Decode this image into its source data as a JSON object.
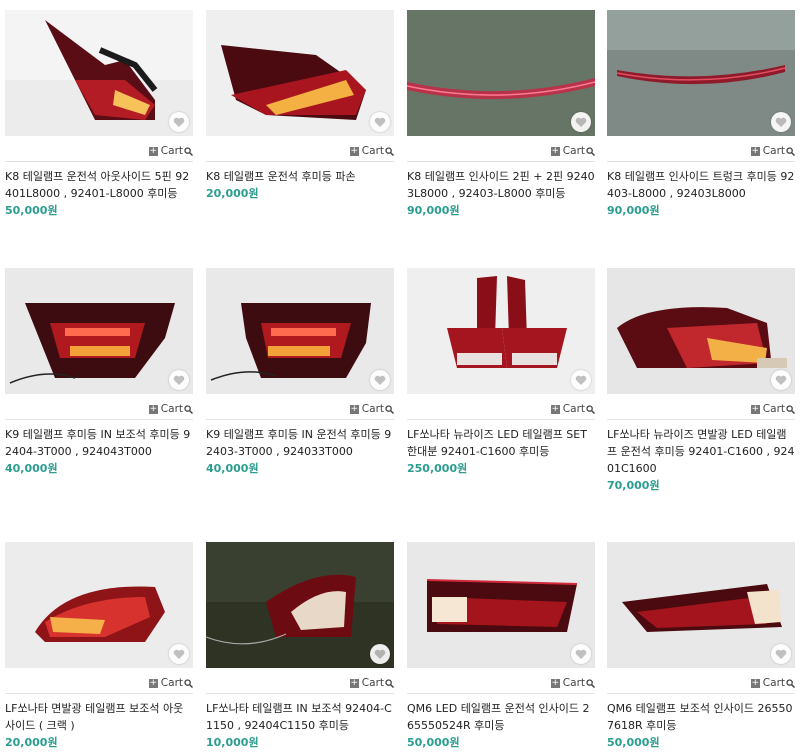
{
  "cart_label": "Cart",
  "accent_price_color": "#2a9d8f",
  "products": [
    {
      "title": "K8 테일램프 운전석 아웃사이드 5핀 92401L8000 , 92401-L8000 후미등",
      "price": "50,000원",
      "image": "outside-taillamp-red"
    },
    {
      "title": "K8 테일램프 운전석 후미등 파손",
      "price": "20,000원",
      "image": "outside-taillamp-red"
    },
    {
      "title": "K8 테일램프 인사이드 2핀 + 2핀 92403L8000 , 92403-L8000 후미등",
      "price": "90,000원",
      "image": "inside-strip-lamp"
    },
    {
      "title": "K8 테일램프 인사이드 트렁크 후미등 92403-L8000 , 92403L8000",
      "price": "90,000원",
      "image": "inside-strip-lamp"
    },
    {
      "title": "K9 테일램프 후미등 IN 보조석 후미등 92404-3T000 , 924043T000",
      "price": "40,000원",
      "image": "trunk-taillamp"
    },
    {
      "title": "K9 테일램프 후미등 IN 운전석 후미등 92403-3T000 , 924033T000",
      "price": "40,000원",
      "image": "trunk-taillamp"
    },
    {
      "title": "LF쏘나타 뉴라이즈 LED 테일램프 SET 한대분 92401-C1600 후미등",
      "price": "250,000원",
      "image": "taillamp-set"
    },
    {
      "title": "LF쏘나타 뉴라이즈 면발광 LED 테일램프 운전석 후미등 92401-C1600 , 92401C1600",
      "price": "70,000원",
      "image": "outside-taillamp-red"
    },
    {
      "title": "LF쏘나타 면발광 테일램프 보조석 아웃사이드 ( 크랙 )",
      "price": "20,000원",
      "image": "outside-taillamp-red"
    },
    {
      "title": "LF쏘나타 테일램프 IN 보조석 92404-C1150 , 92404C1150 후미등",
      "price": "10,000원",
      "image": "inside-lamp-dark"
    },
    {
      "title": "QM6 LED 테일램프 운전석 인사이드 265550524R 후미등",
      "price": "50,000원",
      "image": "qm6-inside-lamp"
    },
    {
      "title": "QM6 테일램프 보조석 인사이드 265507618R 후미등",
      "price": "50,000원",
      "image": "qm6-inside-lamp"
    }
  ]
}
